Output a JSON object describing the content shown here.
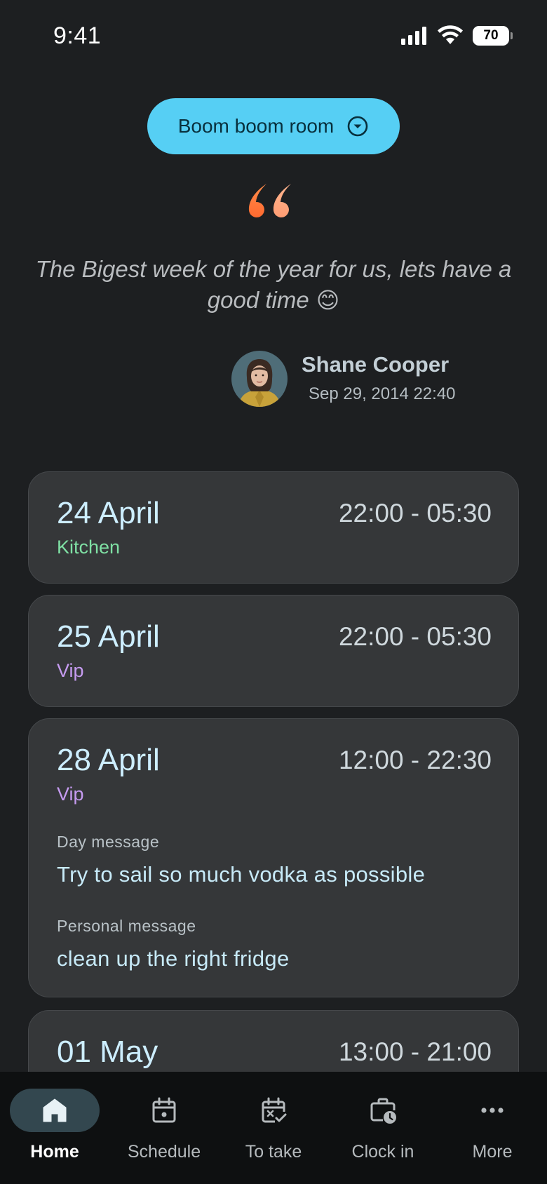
{
  "status_bar": {
    "time": "9:41",
    "battery": "70"
  },
  "room_selector": {
    "label": "Boom boom room"
  },
  "quote": {
    "text": "The Bigest week of the year for us, lets have a good time",
    "emoji": "😊",
    "author": "Shane Cooper",
    "date": "Sep 29, 2014 22:40"
  },
  "shifts": [
    {
      "date": "24 April",
      "time": "22:00 - 05:30",
      "area": "Kitchen"
    },
    {
      "date": "25 April",
      "time": "22:00 - 05:30",
      "area": "Vip"
    },
    {
      "date": "28 April",
      "time": "12:00 - 22:30",
      "area": "Vip",
      "day_message_label": "Day message",
      "day_message": "Try to sail so much vodka as possible",
      "personal_message_label": "Personal message",
      "personal_message": "clean up the right fridge"
    },
    {
      "date": "01 May",
      "time": "13:00 - 21:00"
    }
  ],
  "nav": {
    "items": [
      {
        "label": "Home",
        "icon": "home-icon",
        "active": true
      },
      {
        "label": "Schedule",
        "icon": "calendar-icon"
      },
      {
        "label": "To take",
        "icon": "calendar-check-icon"
      },
      {
        "label": "Clock in",
        "icon": "briefcase-clock-icon"
      },
      {
        "label": "More",
        "icon": "more-dots-icon"
      }
    ]
  },
  "colors": {
    "background": "#1d1f21",
    "accent": "#56cff4",
    "card": "#353739",
    "kitchen": "#7fe0a4",
    "vip": "#c59bf0",
    "quote_mark": "#ff7a3d"
  }
}
